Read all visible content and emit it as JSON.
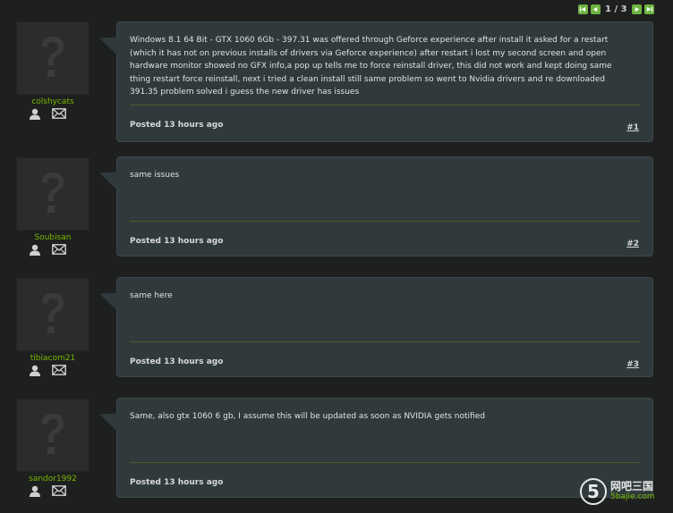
{
  "pagination": {
    "current": "1",
    "separator": "/",
    "total": "3"
  },
  "posts": [
    {
      "username": "colshycats",
      "body": "Windows 8.1 64 Bit - GTX 1060 6Gb - 397.31 was offered through Geforce experience after install it asked for a restart (which it has not on previous installs of drivers via Geforce experience) after restart i lost my second screen and open hardware monitor showed no GFX info,a pop up tells me to force reinstall driver, this did not work and kept doing same thing restart force reinstall, next i tried a clean install still same problem so went to Nvidia drivers and re downloaded 391.35 problem solved i guess the new driver has issues",
      "posted": "Posted 13 hours ago",
      "number": "#1"
    },
    {
      "username": "Soubisan",
      "body": "same issues",
      "posted": "Posted 13 hours ago",
      "number": "#2"
    },
    {
      "username": "tibiacom21",
      "body": "same here",
      "posted": "Posted 13 hours ago",
      "number": "#3"
    },
    {
      "username": "sandor1992",
      "body": "Same, also gtx 1060 6 gb, I assume this will be updated as soon as NVIDIA gets notified",
      "posted": "Posted 13 hours ago",
      "number": ""
    }
  ],
  "watermark": {
    "numeral": "5",
    "name": "网吧三国",
    "sub": "5bajie.com"
  },
  "colors": {
    "accent": "#76b900",
    "bubble": "#303a3c",
    "background": "#1e1f1f"
  }
}
